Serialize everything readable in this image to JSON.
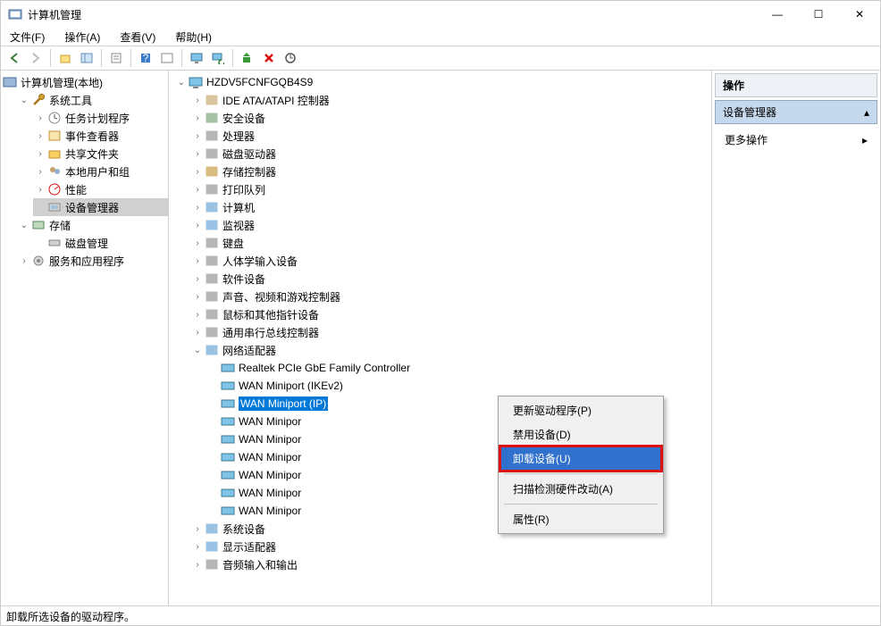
{
  "window": {
    "title": "计算机管理",
    "buttons": {
      "min": "—",
      "max": "☐",
      "close": "✕"
    }
  },
  "menu": {
    "file": "文件(F)",
    "action": "操作(A)",
    "view": "查看(V)",
    "help": "帮助(H)"
  },
  "left_tree": {
    "root": "计算机管理(本地)",
    "system_tools": "系统工具",
    "task_scheduler": "任务计划程序",
    "event_viewer": "事件查看器",
    "shared_folders": "共享文件夹",
    "local_users": "本地用户和组",
    "performance": "性能",
    "device_manager": "设备管理器",
    "storage": "存储",
    "disk_mgmt": "磁盘管理",
    "services_apps": "服务和应用程序"
  },
  "mid_tree": {
    "host": "HZDV5FCNFGQB4S9",
    "ide": "IDE ATA/ATAPI 控制器",
    "security": "安全设备",
    "cpu": "处理器",
    "diskdrive": "磁盘驱动器",
    "storagectrl": "存储控制器",
    "printq": "打印队列",
    "computer": "计算机",
    "monitor": "监视器",
    "keyboard": "键盘",
    "hid": "人体学输入设备",
    "software": "软件设备",
    "sound": "声音、视频和游戏控制器",
    "mouse": "鼠标和其他指针设备",
    "usb": "通用串行总线控制器",
    "network": "网络适配器",
    "net_items": [
      "Realtek PCIe GbE Family Controller",
      "WAN Miniport (IKEv2)",
      "WAN Miniport (IP)",
      "WAN Minipor",
      "WAN Minipor",
      "WAN Minipor",
      "WAN Minipor",
      "WAN Minipor",
      "WAN Minipor"
    ],
    "system": "系统设备",
    "display": "显示适配器",
    "audio": "音频输入和输出"
  },
  "context_menu": {
    "update": "更新驱动程序(P)",
    "disable": "禁用设备(D)",
    "uninstall": "卸载设备(U)",
    "scan": "扫描检测硬件改动(A)",
    "properties": "属性(R)"
  },
  "right": {
    "header": "操作",
    "selected": "设备管理器",
    "more": "更多操作"
  },
  "status": "卸载所选设备的驱动程序。"
}
